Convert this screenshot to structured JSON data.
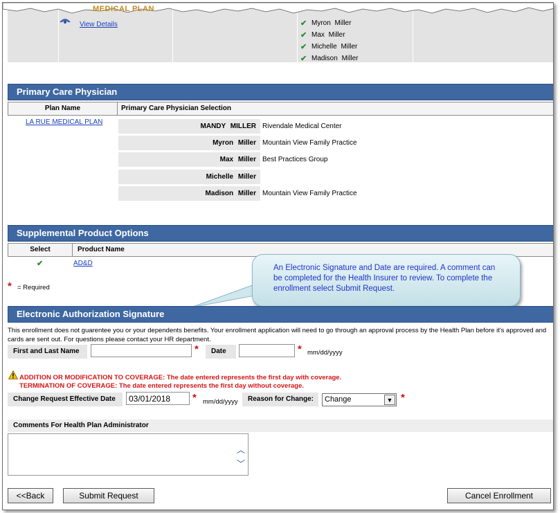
{
  "top_plan": {
    "plan_name_fragment": "MEDICAL PLAN",
    "view_details": "View Details",
    "dependents": [
      "Myron   Miller",
      "Max   Miller",
      "Michelle   Miller",
      "Madison   Miller"
    ]
  },
  "pcp": {
    "section_title": "Primary Care Physician",
    "col_plan": "Plan Name",
    "col_selection": "Primary Care Physician Selection",
    "plan_link": "LA RUE MEDICAL PLAN",
    "rows": [
      {
        "member": "MANDY   MILLER",
        "provider": "Rivendale Medical Center"
      },
      {
        "member": "Myron   Miller",
        "provider": "Mountain View Family Practice"
      },
      {
        "member": "Max   Miller",
        "provider": "Best Practices Group"
      },
      {
        "member": "Michelle   Miller",
        "provider": ""
      },
      {
        "member": "Madison   Miller",
        "provider": "Mountain View Family Practice"
      }
    ]
  },
  "supplemental": {
    "section_title": "Supplemental Product Options",
    "col_select": "Select",
    "col_product": "Product Name",
    "product_link": "AD&D",
    "required_note": "= Required"
  },
  "callout": {
    "text": "An Electronic Signature and Date are required.  A comment can be completed for the Health Insurer to review.  To complete the enrollment select Submit Request."
  },
  "signature": {
    "section_title": "Electronic Authorization Signature",
    "disclaimer": "This enrollment does not guarentee you or your dependents benefits. Your enrollment application will need to go through an approval process by the Health Plan before it's approved and cards are sent out. For questions please contact your HR department.",
    "name_label": "First and Last Name",
    "name_value": "",
    "date_label": "Date",
    "date_value": "",
    "date_hint": "mm/dd/yyyy",
    "warning_add": "ADDITION OR MODIFICATION TO COVERAGE: The date entered represents the first day with coverage.",
    "warning_term": "TERMINATION OF COVERAGE: The date entered represents the first day without coverage.",
    "effective_label": "Change Request Effective Date",
    "effective_value": "03/01/2018",
    "effective_hint": "mm/dd/yyyy",
    "reason_label": "Reason for Change:",
    "reason_value": "Change",
    "comments_label": "Comments For Health Plan Administrator"
  },
  "buttons": {
    "back": "<<Back",
    "submit": "Submit Request",
    "cancel": "Cancel Enrollment"
  },
  "colors": {
    "section_header": "#3f68a2",
    "required": "#d01010",
    "link": "#1a3fbf",
    "callout_text": "#2233cc"
  }
}
